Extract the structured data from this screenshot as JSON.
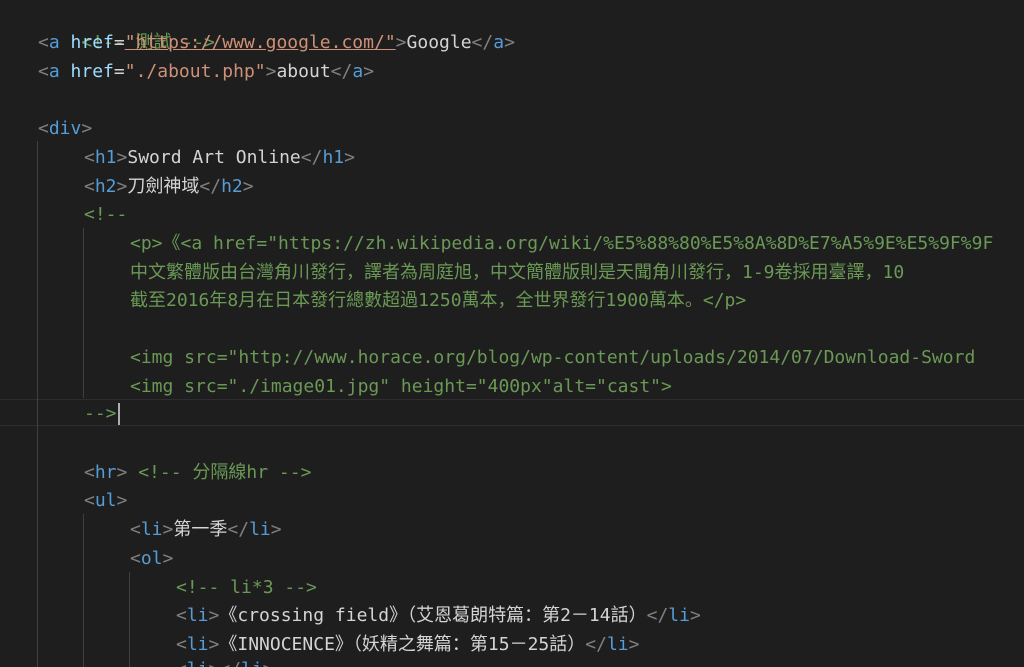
{
  "editor": {
    "l1": {
      "text": "<!-- 測試 -->"
    },
    "l2": {
      "o": "<",
      "tag": "a",
      "attr": "href",
      "eq": "=",
      "val": "\"https://www.google.com/\"",
      "c": ">",
      "text": "Google",
      "eo": "</",
      "etag": "a",
      "ec": ">"
    },
    "l3": {
      "o": "<",
      "tag": "a",
      "attr": "href",
      "eq": "=",
      "val": "\"./about.php\"",
      "c": ">",
      "text": "about",
      "eo": "</",
      "etag": "a",
      "ec": ">"
    },
    "l5": {
      "o": "<",
      "tag": "div",
      "c": ">"
    },
    "l6": {
      "o": "<",
      "tag": "h1",
      "c": ">",
      "text": "Sword Art Online",
      "eo": "</",
      "etag": "h1",
      "ec": ">"
    },
    "l7": {
      "o": "<",
      "tag": "h2",
      "c": ">",
      "text": "刀劍神域",
      "eo": "</",
      "etag": "h2",
      "ec": ">"
    },
    "l8": {
      "text": "<!--"
    },
    "l9": {
      "text": "<p>《<a href=\"https://zh.wikipedia.org/wiki/%E5%88%80%E5%8A%8D%E7%A5%9E%E5%9F%9F"
    },
    "l10": {
      "text": "中文繁體版由台灣角川發行，譯者為周庭旭，中文簡體版則是天聞角川發行，1-9卷採用臺譯，10"
    },
    "l11": {
      "text": "截至2016年8月在日本發行總數超過1250萬本，全世界發行1900萬本。</p>"
    },
    "l13": {
      "text": "<img src=\"http://www.horace.org/blog/wp-content/uploads/2014/07/Download-Sword"
    },
    "l14": {
      "text": "<img src=\"./image01.jpg\" height=\"400px\"alt=\"cast\">"
    },
    "l15": {
      "text": "-->"
    },
    "l17": {
      "o": "<",
      "tag": "hr",
      "c": ">",
      "comment": "<!-- 分隔線hr -->"
    },
    "l18": {
      "o": "<",
      "tag": "ul",
      "c": ">"
    },
    "l19": {
      "o": "<",
      "tag": "li",
      "c": ">",
      "text": "第一季",
      "eo": "</",
      "etag": "li",
      "ec": ">"
    },
    "l20": {
      "o": "<",
      "tag": "ol",
      "c": ">"
    },
    "l21": {
      "text": "<!-- li*3 -->"
    },
    "l22": {
      "o": "<",
      "tag": "li",
      "c": ">",
      "text": "《crossing field》（艾恩葛朗特篇：第2－14話）",
      "eo": "</",
      "etag": "li",
      "ec": ">"
    },
    "l23": {
      "o": "<",
      "tag": "li",
      "c": ">",
      "text": "《INNOCENCE》（妖精之舞篇：第15－25話）",
      "eo": "</",
      "etag": "li",
      "ec": ">"
    },
    "l24": {
      "o": "<",
      "tag": "li",
      "c": ">",
      "eo": "</",
      "etag": "li",
      "ec": ">"
    }
  }
}
